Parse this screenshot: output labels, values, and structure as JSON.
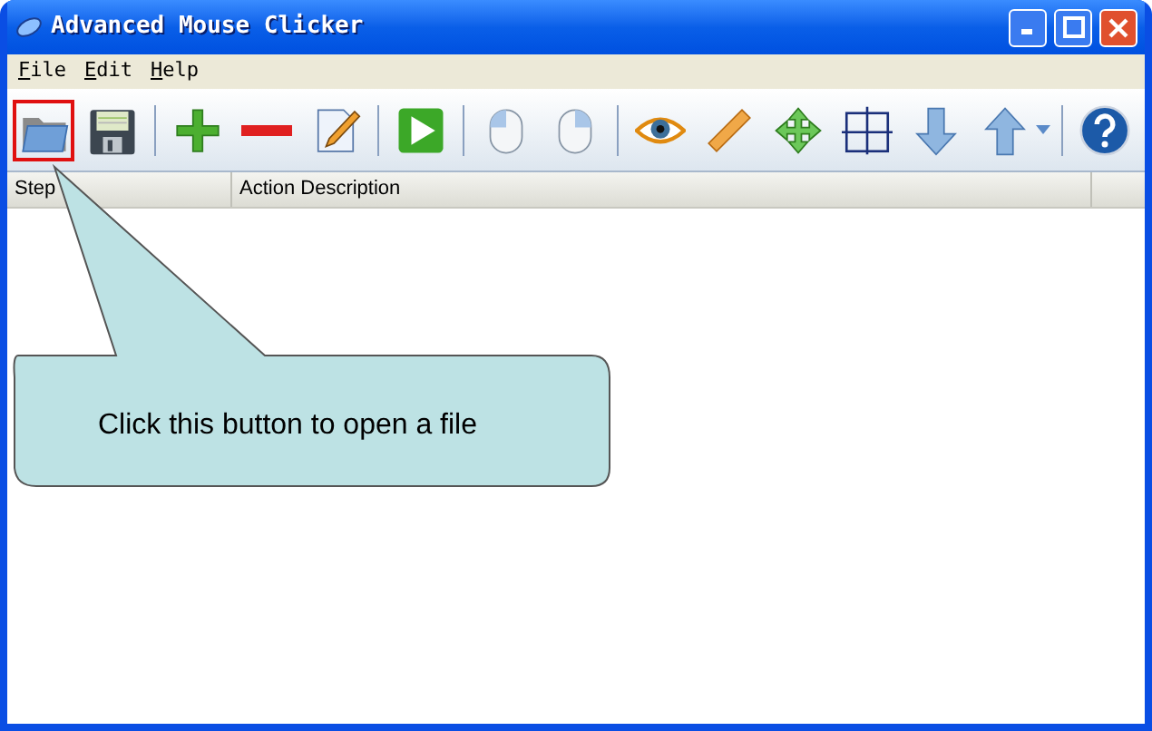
{
  "window": {
    "title": "Advanced Mouse Clicker"
  },
  "menu": [
    "File",
    "Edit",
    "Help"
  ],
  "toolbar": [
    {
      "kind": "button",
      "highlighted": true
    },
    {
      "kind": "button",
      "highlighted": false
    },
    {
      "kind": "separator"
    },
    {
      "kind": "button",
      "highlighted": false
    },
    {
      "kind": "button",
      "highlighted": false
    },
    {
      "kind": "button",
      "highlighted": false
    },
    {
      "kind": "separator"
    },
    {
      "kind": "button",
      "highlighted": false
    },
    {
      "kind": "separator"
    },
    {
      "kind": "button",
      "highlighted": false
    },
    {
      "kind": "button",
      "highlighted": false
    },
    {
      "kind": "separator"
    },
    {
      "kind": "button",
      "highlighted": false
    },
    {
      "kind": "button",
      "highlighted": false
    },
    {
      "kind": "button",
      "highlighted": false
    },
    {
      "kind": "button",
      "highlighted": false
    },
    {
      "kind": "button",
      "highlighted": false
    },
    {
      "kind": "dropdown",
      "highlighted": false
    },
    {
      "kind": "separator"
    },
    {
      "kind": "button",
      "highlighted": false
    }
  ],
  "table": {
    "columns": [
      "Step",
      "Action Description"
    ]
  },
  "callout": {
    "text": "Click this button to open a file"
  }
}
